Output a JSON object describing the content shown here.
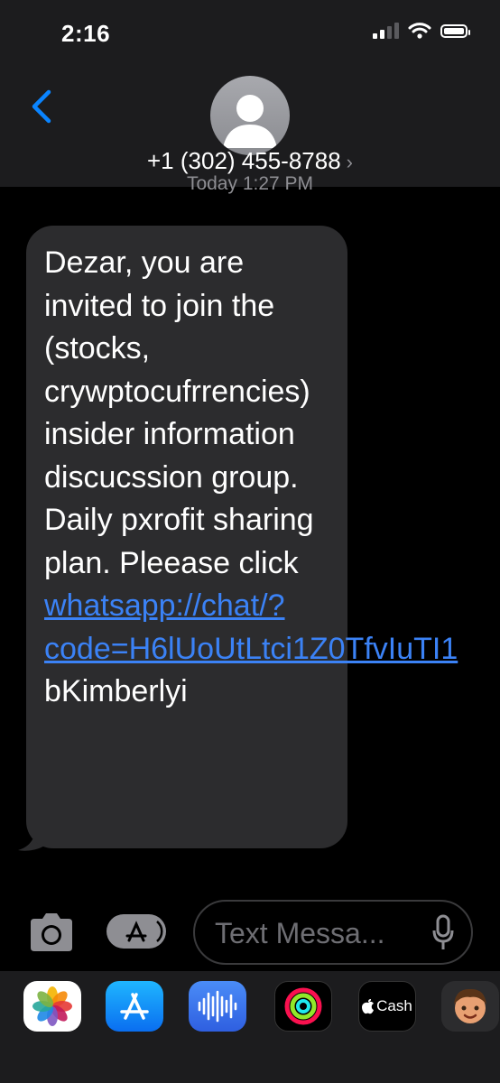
{
  "status_bar": {
    "time": "2:16"
  },
  "header": {
    "contact_number": "+1 (302) 455-8788",
    "chevron": "›"
  },
  "conversation": {
    "timestamp": "Today 1:27 PM",
    "message": {
      "text_before_link": "Dezar, you are invited to join the (stocks, crywptocufrrencies) insider information discucssion group. Daily pxrofit sharing plan. Pleease click",
      "link": "whatsapp://chat/?code=H6lUoUtLtci1Z0TfvIuTI1",
      "text_after_link": "bKimberlyi"
    }
  },
  "composer": {
    "placeholder": "Text Messa..."
  },
  "app_drawer": {
    "apps": [
      {
        "name": "photos-icon"
      },
      {
        "name": "app-store-icon"
      },
      {
        "name": "audio-message-icon"
      },
      {
        "name": "activity-icon"
      },
      {
        "name": "apple-cash-icon",
        "label": "Cash"
      },
      {
        "name": "memoji-icon"
      }
    ]
  },
  "colors": {
    "link": "#3b82f6",
    "bubble": "#2c2c2e",
    "header": "#1c1c1e",
    "accent_blue": "#0a84ff"
  }
}
